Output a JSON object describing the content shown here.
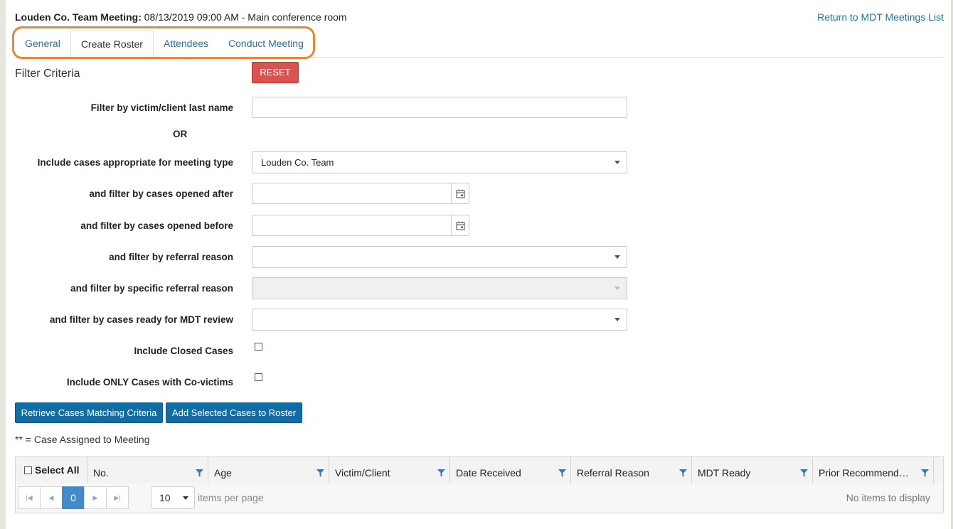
{
  "header": {
    "meeting_title": "Louden Co. Team Meeting:",
    "meeting_details": " 08/13/2019 09:00 AM - Main conference room",
    "return_link": "Return to MDT Meetings List"
  },
  "tabs": [
    {
      "label": "General",
      "active": false
    },
    {
      "label": "Create Roster",
      "active": true
    },
    {
      "label": "Attendees",
      "active": false
    },
    {
      "label": "Conduct Meeting",
      "active": false
    }
  ],
  "filter": {
    "section_title": "Filter Criteria",
    "reset_label": "RESET",
    "last_name_label": "Filter by victim/client last name",
    "last_name_value": "",
    "or_label": "OR",
    "meeting_type_label": "Include cases appropriate for meeting type",
    "meeting_type_value": "Louden Co. Team",
    "opened_after_label": "and filter by cases opened after",
    "opened_after_value": "",
    "opened_before_label": "and filter by cases opened before",
    "opened_before_value": "",
    "referral_reason_label": "and filter by referral reason",
    "referral_reason_value": "",
    "specific_referral_label": "and filter by specific referral reason",
    "specific_referral_value": "",
    "mdt_ready_label": "and filter by cases ready for MDT review",
    "mdt_ready_value": "",
    "closed_cases_label": "Include Closed Cases",
    "closed_cases_checked": false,
    "covictims_label": "Include ONLY Cases with Co-victims",
    "covictims_checked": false
  },
  "actions": {
    "retrieve_label": "Retrieve Cases Matching Criteria",
    "add_label": "Add Selected Cases to Roster"
  },
  "note": "** = Case Assigned to Meeting",
  "grid": {
    "select_all_label": "Select All",
    "columns": [
      "No.",
      "Age",
      "Victim/Client",
      "Date Received",
      "Referral Reason",
      "MDT Ready",
      "Prior Recommend…"
    ],
    "rows": [],
    "pager": {
      "current_page": "0",
      "page_size": "10",
      "items_per_page_label": "items per page",
      "empty_message": "No items to display"
    }
  },
  "colors": {
    "link": "#2a6ea6",
    "reset": "#d9534f",
    "primary": "#0f6ea8",
    "highlight": "#f0852d",
    "pager_active": "#428bca"
  },
  "icons": [
    "calendar-icon",
    "filter-icon",
    "chevron-down-icon",
    "first-page-icon",
    "prev-page-icon",
    "next-page-icon",
    "last-page-icon"
  ]
}
